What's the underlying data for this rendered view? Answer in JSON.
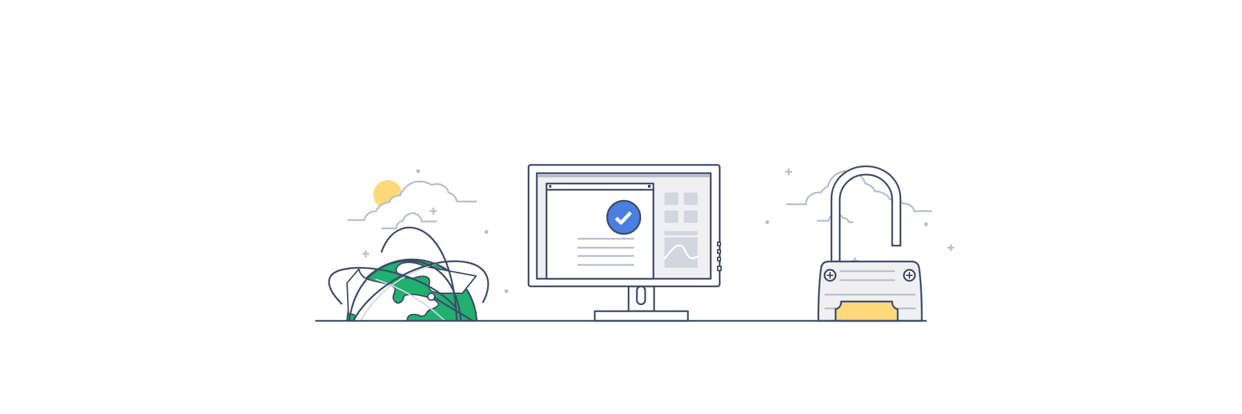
{
  "illustration": {
    "elements": [
      "sun",
      "clouds",
      "globe",
      "monitor",
      "checkmark-badge",
      "padlock-open",
      "sparkles"
    ]
  },
  "colors": {
    "outline": "#3F4A66",
    "light_outline": "#B7BDCC",
    "sun": "#FFD97A",
    "globe_land": "#20B070",
    "check_badge": "#4A7FE0",
    "lock_plate": "#FFD97A",
    "screen_bg": "#F0F0F2",
    "tile": "#D3D6DE",
    "chart_fill": "#B7BDCC"
  }
}
